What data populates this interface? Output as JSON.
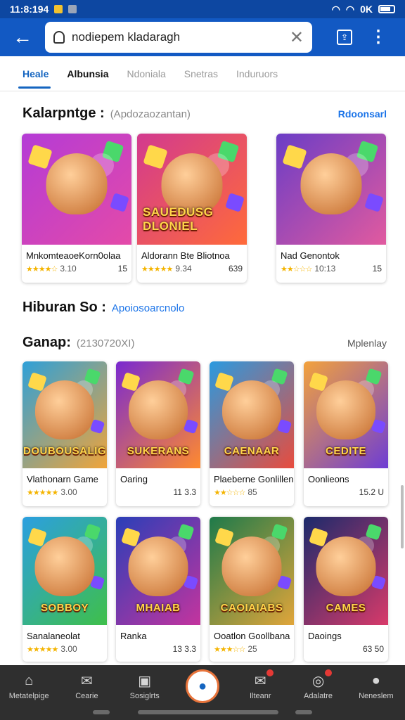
{
  "status": {
    "time": "11:8:194",
    "right": "0K"
  },
  "search": {
    "value": "nodiepem kladaragh"
  },
  "tabs": [
    "Heale",
    "Albunsia",
    "Ndoniala",
    "Snetras",
    "Induruors"
  ],
  "section1": {
    "title": "Kalarpntge :",
    "subtitle": "(Apdozaozantan)",
    "link": "Rdoonsarl",
    "cards": [
      {
        "title": "MnkomteaoeKorn0olaa",
        "stars": "★★★★☆",
        "rating": "3.10",
        "num": "15",
        "banner": "",
        "colors": [
          "#b43bd6",
          "#e44aa8"
        ]
      },
      {
        "title": "Aldorann Bte Bliotnoa",
        "stars": "★★★★★",
        "rating": "9.34",
        "num": "639",
        "banner": "SAUEDUSG DLONIEL",
        "colors": [
          "#d23a8f",
          "#ff6a3a"
        ]
      },
      {
        "title": "Nad Genontok",
        "stars": "★★☆☆☆",
        "rating": "10:13",
        "num": "15",
        "banner": "",
        "colors": [
          "#6b3dc6",
          "#e15a9f"
        ]
      }
    ]
  },
  "section2": {
    "title": "Hiburan So :",
    "subtitle": "Apoiosoarcnolo"
  },
  "section3": {
    "title": "Ganap:",
    "subtitle": "(2130720XI)",
    "link": "Mplenlay",
    "row1": [
      {
        "title": "Vlathonarn Game",
        "stars": "★★★★★",
        "rating": "3.00",
        "num": "",
        "banner": "DOUBOUSALIG",
        "colors": [
          "#2ea0d8",
          "#f0a43a"
        ]
      },
      {
        "title": "Oaring",
        "stars": "",
        "rating": "",
        "num": "11 3.3",
        "banner": "SUKERANS",
        "colors": [
          "#7a2ad0",
          "#ff8a2e"
        ]
      },
      {
        "title": "Plaeberne Gonlillen",
        "stars": "★★☆☆☆",
        "rating": "85",
        "num": "",
        "banner": "CAENAAR",
        "colors": [
          "#2a9ae0",
          "#e84c3d"
        ]
      },
      {
        "title": "Oonlieons",
        "stars": "",
        "rating": "",
        "num": "15.2 U",
        "banner": "CEDITE",
        "colors": [
          "#f3a23c",
          "#6e3dd4"
        ]
      }
    ],
    "row2": [
      {
        "title": "Sanalaneolat",
        "stars": "★★★★★",
        "rating": "3.00",
        "num": "",
        "banner": "SOBBOY",
        "colors": [
          "#2b9fe0",
          "#3fbf4a"
        ]
      },
      {
        "title": "Ranka",
        "stars": "",
        "rating": "",
        "num": "13 3.3",
        "banner": "MHAIAB",
        "colors": [
          "#2a3fb8",
          "#c4349e"
        ]
      },
      {
        "title": "Ooatlon Goollbana",
        "stars": "★★★☆☆",
        "rating": "25",
        "num": "",
        "banner": "CAOIAIABS",
        "colors": [
          "#1e7a4a",
          "#e0a53a"
        ]
      },
      {
        "title": "Daoings",
        "stars": "",
        "rating": "",
        "num": "63 50",
        "banner": "CAMES",
        "colors": [
          "#1b2a6b",
          "#d83a6a"
        ]
      }
    ]
  },
  "nav": [
    "Metatelpige",
    "Cearie",
    "Sosiglrts",
    "",
    "Ilteanr",
    "Adalatre",
    "Neneslem"
  ],
  "colors": {
    "primary": "#1259c3",
    "statusbar": "#0d47a1",
    "accent": "#1a73e8",
    "fab_ring": "#e8743b",
    "nav_bg": "#2f2f2f"
  }
}
